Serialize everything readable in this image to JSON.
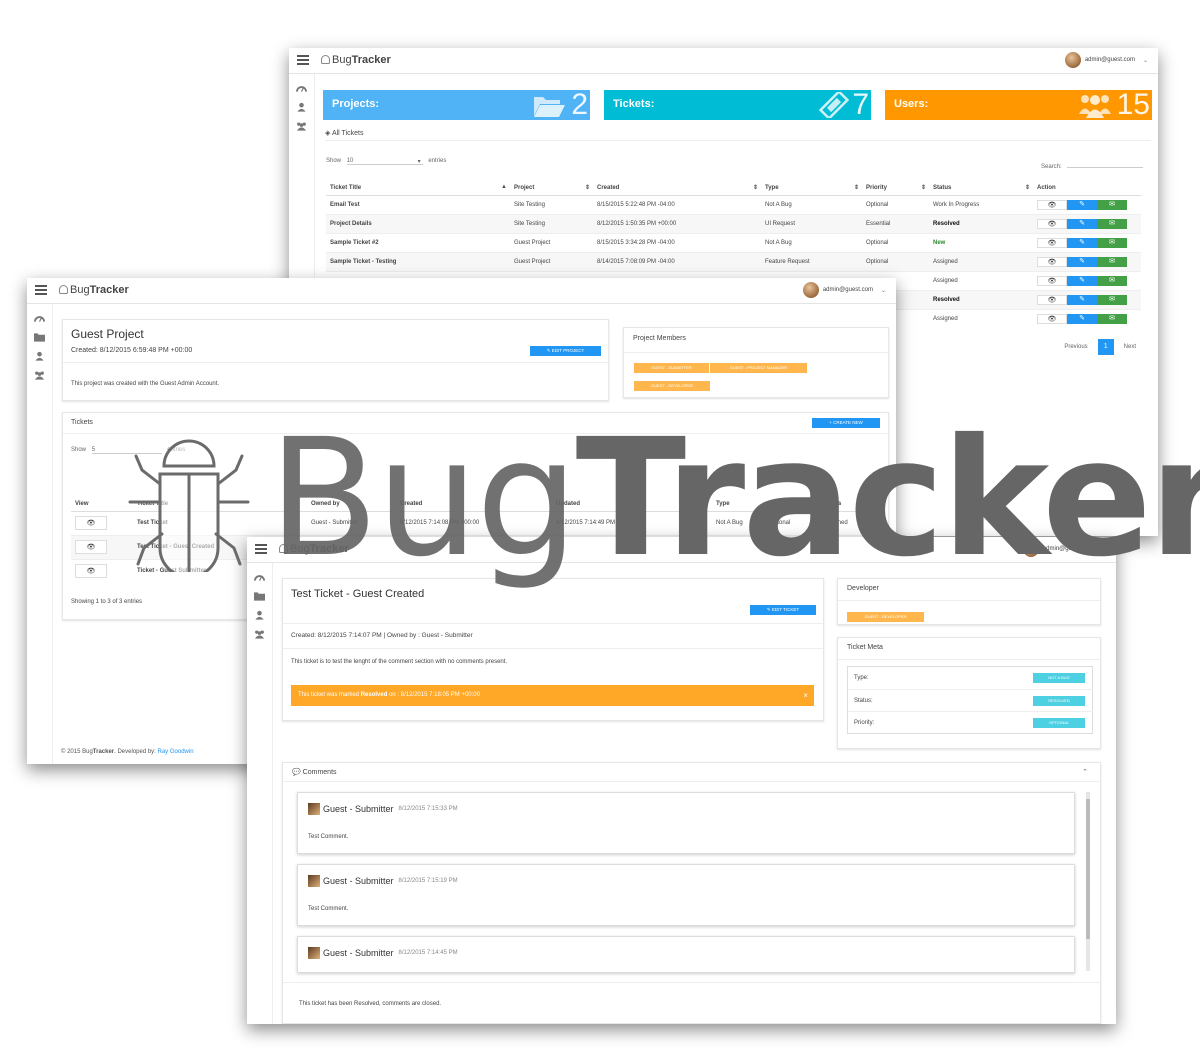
{
  "brand": {
    "prefix": "Bug",
    "suffix": "Tracker"
  },
  "user": {
    "email": "admin@guest.com"
  },
  "dashboard": {
    "stats": [
      {
        "label": "Projects:",
        "value": "2",
        "color": "#4fb3f5",
        "icon": "folder-open-icon"
      },
      {
        "label": "Tickets:",
        "value": "7",
        "color": "#00bcd4",
        "icon": "ticket-icon"
      },
      {
        "label": "Users:",
        "value": "15",
        "color": "#ff9800",
        "icon": "users-icon"
      }
    ],
    "panel_title": "All Tickets",
    "show_label": "Show",
    "entries_value": "10",
    "entries_label": "entries",
    "search_label": "Search:",
    "columns": [
      "Ticket Title",
      "Project",
      "Created",
      "Type",
      "Priority",
      "Status",
      "Action"
    ],
    "rows": [
      {
        "title": "Email Test",
        "project": "Site Testing",
        "created": "8/15/2015 5:22:48 PM -04:00",
        "type": "Not A Bug",
        "priority": "Optional",
        "status": "Work In Progress"
      },
      {
        "title": "Project Details",
        "project": "Site Testing",
        "created": "8/12/2015 1:50:35 PM +00:00",
        "type": "UI Request",
        "priority": "Essential",
        "status": "Resolved"
      },
      {
        "title": "Sample Ticket #2",
        "project": "Guest Project",
        "created": "8/15/2015 3:34:28 PM -04:00",
        "type": "Not A Bug",
        "priority": "Optional",
        "status": "New"
      },
      {
        "title": "Sample Ticket - Testing",
        "project": "Guest Project",
        "created": "8/14/2015 7:08:09 PM -04:00",
        "type": "Feature Request",
        "priority": "Optional",
        "status": "Assigned"
      }
    ],
    "hidden_statuses": [
      "Assigned",
      "Resolved",
      "Assigned"
    ],
    "pager": {
      "prev": "Previous",
      "current": "1",
      "next": "Next"
    }
  },
  "project": {
    "title": "Guest Project",
    "created": "Created: 8/12/2015 6:59:48 PM +00:00",
    "edit_label": "EDIT PROJECT",
    "description": "This project was created with the Guest Admin Account.",
    "members_title": "Project Members",
    "members": [
      "GUEST - SUBMITTER",
      "GUEST - PROJECT MANAGER",
      "GUEST - DEVELOPER"
    ],
    "tickets_title": "Tickets",
    "create_label": "CREATE NEW",
    "show_label": "Show",
    "entries_value": "5",
    "entries_label": "entries",
    "columns": [
      "View",
      "Ticket Title",
      "Owned by",
      "Created",
      "Updated",
      "Type",
      "Priority",
      "Status"
    ],
    "rows": [
      {
        "title": "Test Ticket",
        "owner": "Guest - Submitter",
        "created": "8/12/2015 7:14:08 PM +00:00",
        "updated": "8/12/2015 7:14:49 PM +00:00",
        "type": "Not A Bug",
        "priority": "Optional",
        "status": "Assigned"
      },
      {
        "title": "Test Ticket - Guest Created"
      },
      {
        "title": "Ticket - Guest Submitter"
      }
    ],
    "showing": "Showing 1 to 3 of 3 entries",
    "footer": {
      "copy": "© 2015 Bug",
      "bold": "Tracker",
      "dev": ". Developed by:",
      "author": "Ray Goodwin"
    }
  },
  "ticket": {
    "title": "Test Ticket - Guest Created",
    "edit_label": "EDIT TICKET",
    "created": "Created: 8/12/2015 7:14:07 PM | Owned by : Guest - Submitter",
    "description": "This ticket is to test the lenght of the comment section with no comments present.",
    "alert": {
      "pre": "This ticket was marked",
      "bold": "Resolved",
      "post": "on : 8/12/2015 7:18:05 PM +00:00"
    },
    "developer_title": "Developer",
    "developer": "GUEST - DEVELOPER",
    "meta_title": "Ticket Meta",
    "meta": [
      {
        "label": "Type:",
        "value": "NOT A BUG"
      },
      {
        "label": "Status:",
        "value": "RESOLVED"
      },
      {
        "label": "Priority:",
        "value": "OPTIONAL"
      }
    ],
    "comments_title": "Comments",
    "comments": [
      {
        "author": "Guest - Submitter",
        "time": "8/12/2015 7:15:33 PM",
        "body": "Test Comment."
      },
      {
        "author": "Guest - Submitter",
        "time": "8/12/2015 7:15:19 PM",
        "body": "Test Comment."
      },
      {
        "author": "Guest - Submitter",
        "time": "8/12/2015 7:14:45 PM",
        "body": ""
      }
    ],
    "closed_note": "This ticket has been Resolved, comments are closed."
  },
  "logo": {
    "thin": "Bug",
    "heavy": "Tracker"
  }
}
